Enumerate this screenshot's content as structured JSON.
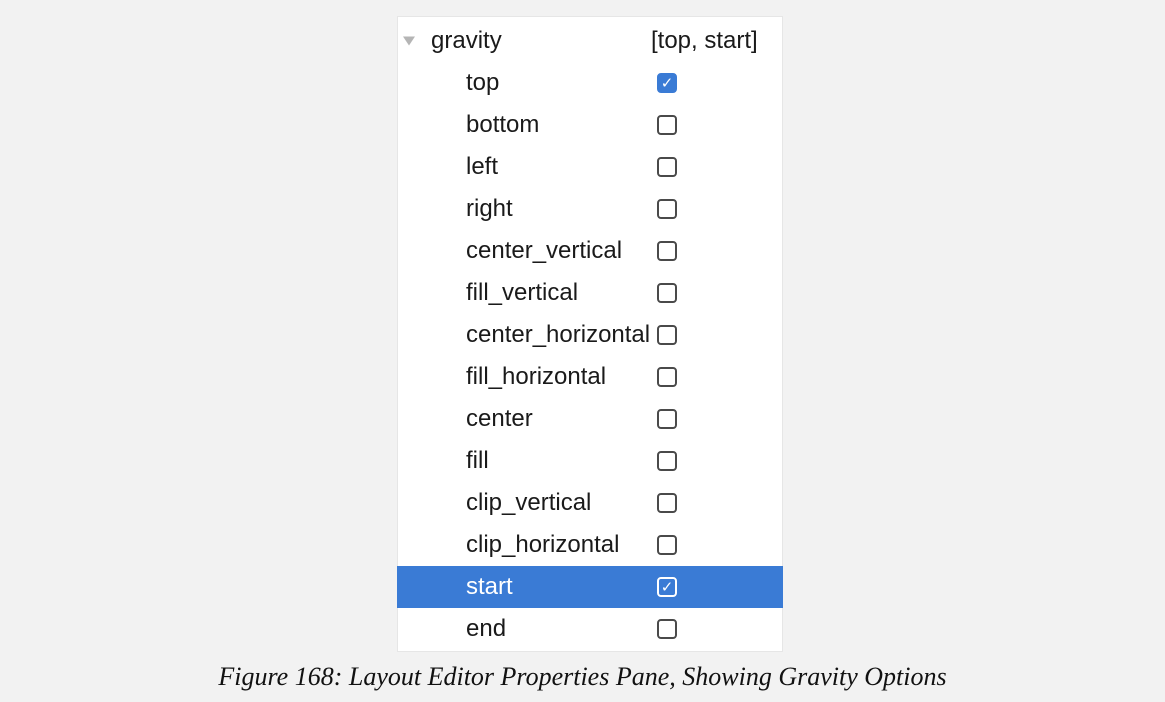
{
  "property": {
    "name": "gravity",
    "value": "[top, start]"
  },
  "options": [
    {
      "label": "top",
      "checked": true,
      "selected": false
    },
    {
      "label": "bottom",
      "checked": false,
      "selected": false
    },
    {
      "label": "left",
      "checked": false,
      "selected": false
    },
    {
      "label": "right",
      "checked": false,
      "selected": false
    },
    {
      "label": "center_vertical",
      "checked": false,
      "selected": false
    },
    {
      "label": "fill_vertical",
      "checked": false,
      "selected": false
    },
    {
      "label": "center_horizontal",
      "checked": false,
      "selected": false
    },
    {
      "label": "fill_horizontal",
      "checked": false,
      "selected": false
    },
    {
      "label": "center",
      "checked": false,
      "selected": false
    },
    {
      "label": "fill",
      "checked": false,
      "selected": false
    },
    {
      "label": "clip_vertical",
      "checked": false,
      "selected": false
    },
    {
      "label": "clip_horizontal",
      "checked": false,
      "selected": false
    },
    {
      "label": "start",
      "checked": true,
      "selected": true
    },
    {
      "label": "end",
      "checked": false,
      "selected": false
    }
  ],
  "caption": "Figure 168: Layout Editor Properties Pane, Showing Gravity Options",
  "colors": {
    "selection": "#3a7bd5",
    "checkbox_checked": "#3a7bd5"
  }
}
